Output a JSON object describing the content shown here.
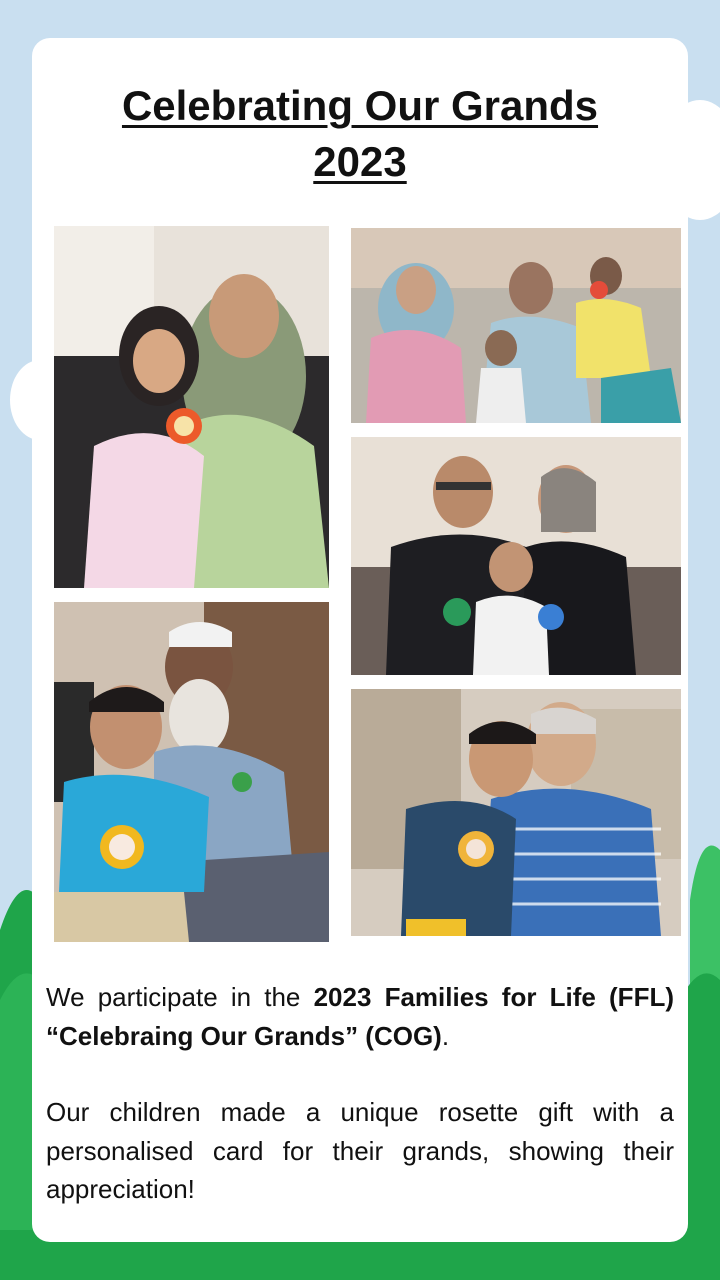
{
  "colors": {
    "sky": "#c9dff0",
    "grass_dark": "#1fa54a",
    "grass_light": "#3cc165",
    "card": "#ffffff",
    "text": "#111111"
  },
  "title": {
    "line1": "Celebrating Our Grands",
    "line2": "2023"
  },
  "photos": [
    {
      "name": "photo-grandmother-with-girl"
    },
    {
      "name": "photo-grandparents-with-boys"
    },
    {
      "name": "photo-grandparents-couple-with-boy"
    },
    {
      "name": "photo-grandfather-with-boy-in-blue"
    },
    {
      "name": "photo-grandfather-striped-shirt-with-boy"
    }
  ],
  "body": {
    "p1_pre": "We participate in the ",
    "p1_bold1": "2023 Families for Life (FFL) “Celebraing Our Grands” (COG)",
    "p1_post": ".",
    "p2": "Our children made a unique rosette gift with a personalised card for their grands, showing their appreciation!"
  }
}
